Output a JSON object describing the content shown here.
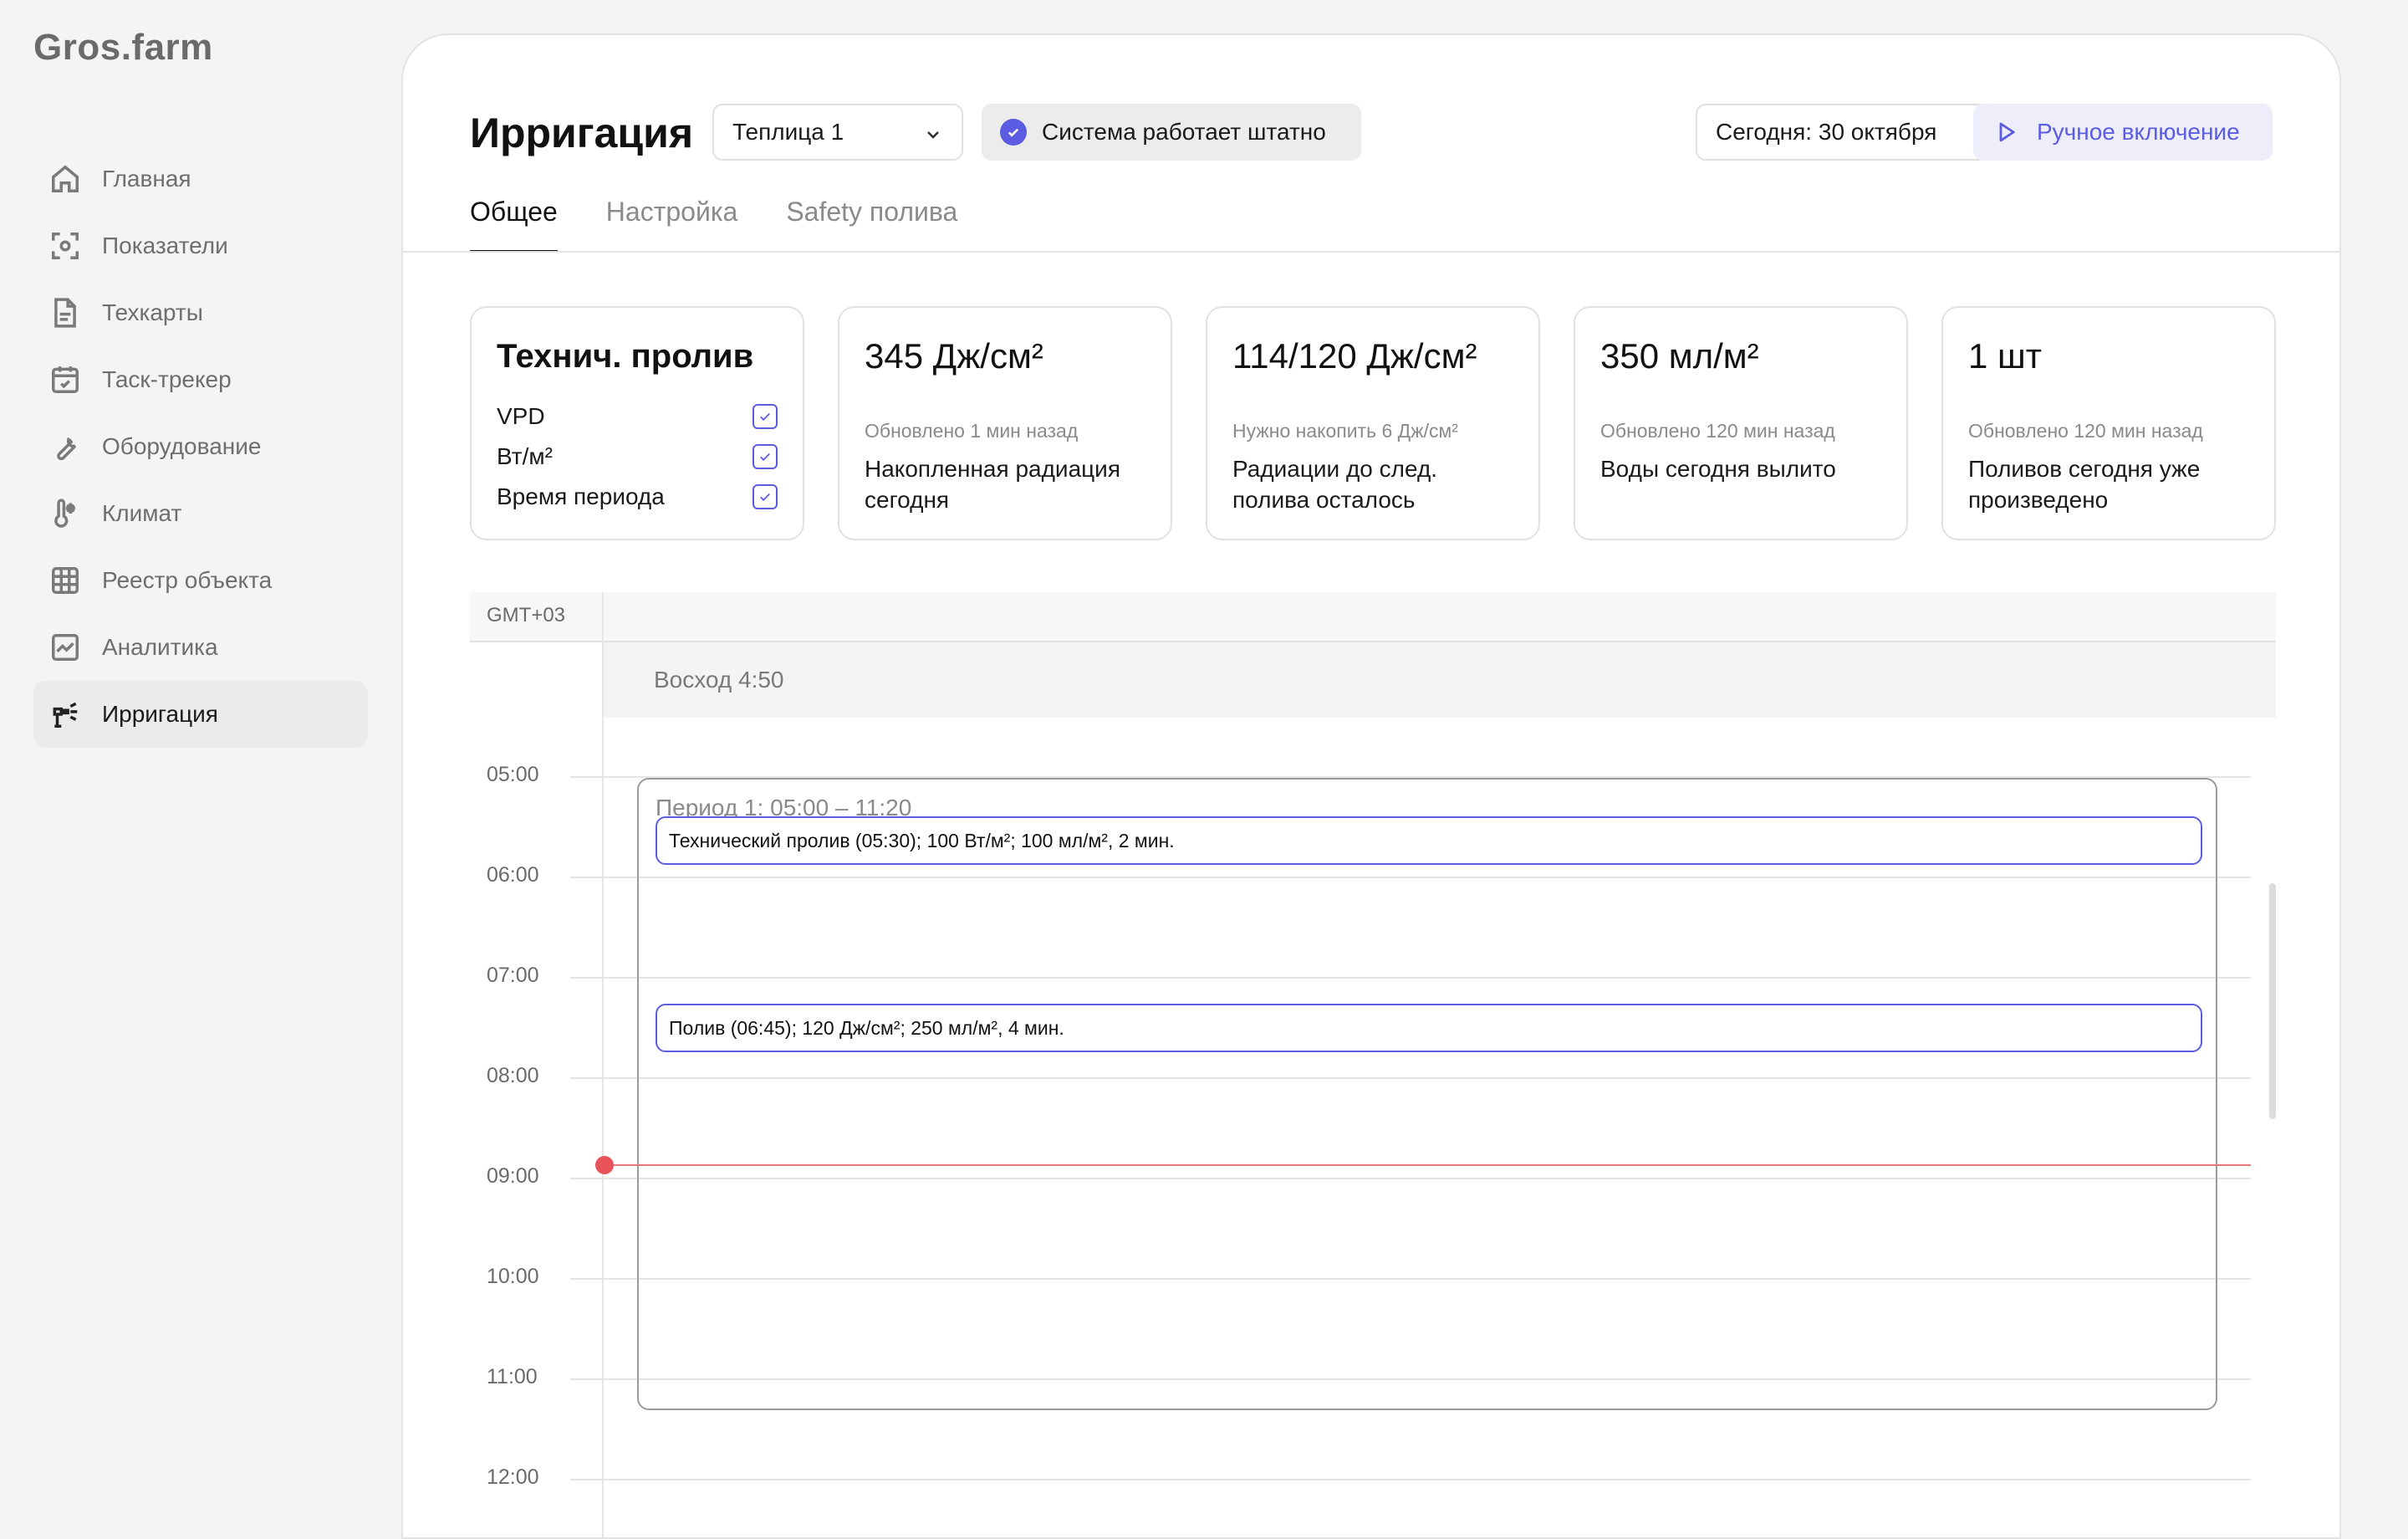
{
  "app": {
    "logo": "Gros.farm"
  },
  "sidebar": {
    "items": [
      {
        "label": "Главная",
        "icon": "home-icon"
      },
      {
        "label": "Показатели",
        "icon": "metrics-icon"
      },
      {
        "label": "Техкарты",
        "icon": "document-icon"
      },
      {
        "label": "Таск-трекер",
        "icon": "calendar-icon"
      },
      {
        "label": "Оборудование",
        "icon": "wrench-icon"
      },
      {
        "label": "Климат",
        "icon": "thermometer-icon"
      },
      {
        "label": "Реестр объекта",
        "icon": "grid-icon"
      },
      {
        "label": "Аналитика",
        "icon": "analytics-icon"
      },
      {
        "label": "Ирригация",
        "icon": "sprinkler-icon",
        "active": true
      }
    ]
  },
  "header": {
    "title": "Ирригация",
    "greenhouse_select": "Теплица 1",
    "status": "Система работает штатно",
    "date_select": "Сегодня: 30 октября",
    "manual_button": "Ручное включение"
  },
  "tabs": [
    "Общее",
    "Настройка",
    "Safety полива"
  ],
  "cards": {
    "tech": {
      "title": "Технич. пролив",
      "options": [
        {
          "label": "VPD",
          "checked": true
        },
        {
          "label": "Вт/м²",
          "checked": true
        },
        {
          "label": "Время периода",
          "checked": true
        }
      ]
    },
    "metrics": [
      {
        "value": "345 Дж/см²",
        "sub": "Обновлено 1 мин назад",
        "desc": "Накопленная радиация сегодня"
      },
      {
        "value": "114/120 Дж/см²",
        "sub": "Нужно накопить 6 Дж/см²",
        "desc": "Радиации до след. полива осталось"
      },
      {
        "value": "350 мл/м²",
        "sub": "Обновлено 120 мин назад",
        "desc": "Воды сегодня вылито"
      },
      {
        "value": "1 шт",
        "sub": "Обновлено 120 мин назад",
        "desc": "Поливов сегодня уже произведено"
      }
    ]
  },
  "schedule": {
    "timezone": "GMT+03",
    "sunrise": "Восход 4:50",
    "hours": [
      "05:00",
      "06:00",
      "07:00",
      "08:00",
      "09:00",
      "10:00",
      "11:00",
      "12:00"
    ],
    "period_title": "Период 1: 05:00 – 11:20",
    "events": [
      "Технический пролив (05:30); 100 Вт/м²;  100 мл/м², 2 мин.",
      "Полив (06:45); 120 Дж/см²; 250 мл/м², 4 мин."
    ],
    "now_color": "#e8545a",
    "accent": "#5b5ce2"
  }
}
